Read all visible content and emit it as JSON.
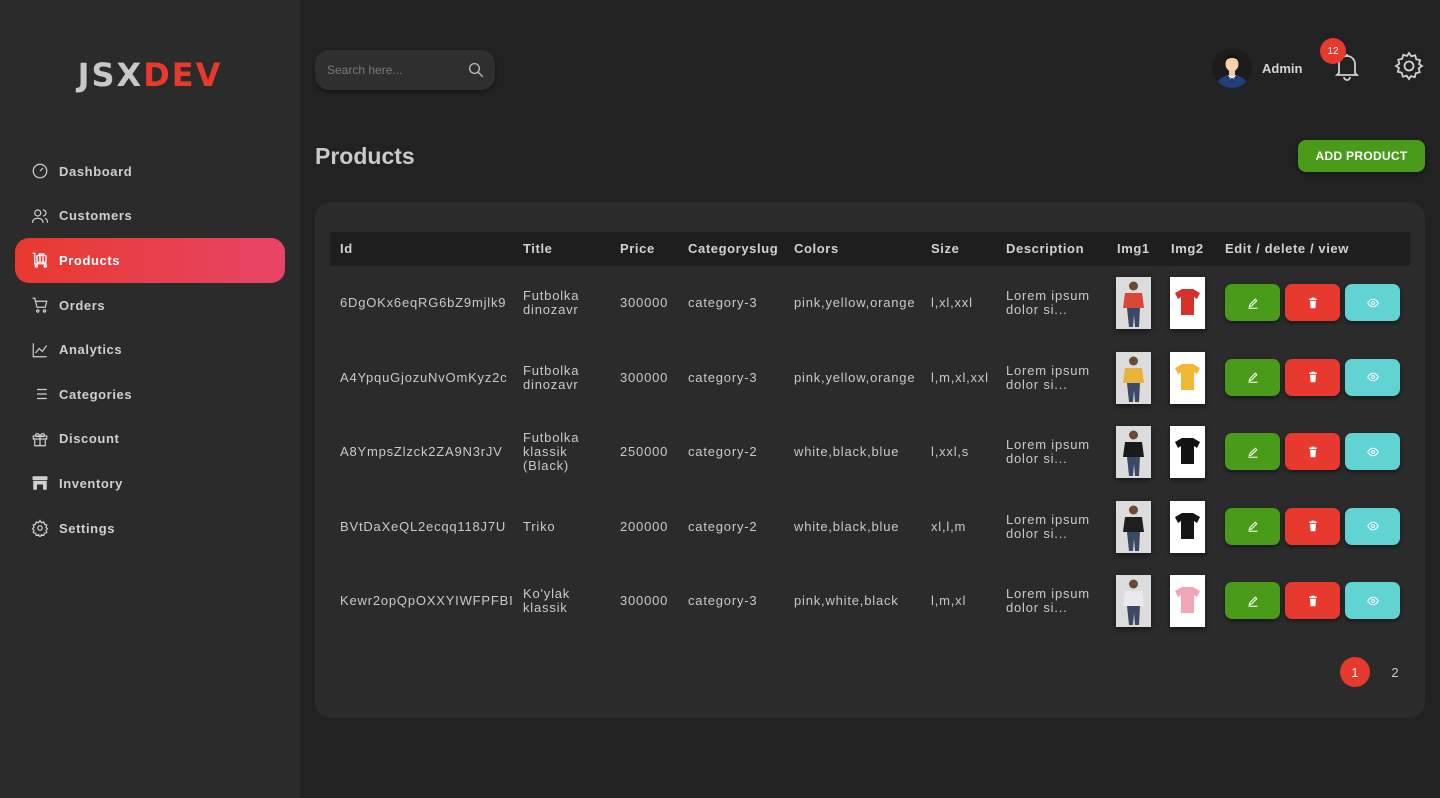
{
  "brand": {
    "part1": "JSX",
    "part2": "DEV"
  },
  "sidebar": {
    "items": [
      {
        "label": "Dashboard",
        "icon": "gauge-icon",
        "active": false
      },
      {
        "label": "Customers",
        "icon": "users-icon",
        "active": false
      },
      {
        "label": "Products",
        "icon": "luggage-cart-icon",
        "active": true
      },
      {
        "label": "Orders",
        "icon": "cart-icon",
        "active": false
      },
      {
        "label": "Analytics",
        "icon": "line-chart-icon",
        "active": false
      },
      {
        "label": "Categories",
        "icon": "list-icon",
        "active": false
      },
      {
        "label": "Discount",
        "icon": "gift-icon",
        "active": false
      },
      {
        "label": "Inventory",
        "icon": "store-icon",
        "active": false
      },
      {
        "label": "Settings",
        "icon": "gear-icon",
        "active": false
      }
    ]
  },
  "header": {
    "search_placeholder": "Search here...",
    "user_name": "Admin",
    "notification_count": "12"
  },
  "page": {
    "title": "Products",
    "add_button": "ADD PRODUCT"
  },
  "table": {
    "columns": [
      "Id",
      "Title",
      "Price",
      "Categoryslug",
      "Colors",
      "Size",
      "Description",
      "Img1",
      "Img2",
      "Edit / delete / view"
    ],
    "rows": [
      {
        "id": "6DgOKx6eqRG6bZ9mjlk9",
        "title": "Futbolka dinozavr",
        "price": "300000",
        "category": "category-3",
        "colors": "pink,yellow,orange",
        "size": "l,xl,xxl",
        "description": "Lorem ipsum dolor si...",
        "img1_color": "#d9473b",
        "img2_color": "#d6312b"
      },
      {
        "id": "A4YpquGjozuNvOmKyz2c",
        "title": "Futbolka dinozavr",
        "price": "300000",
        "category": "category-3",
        "colors": "pink,yellow,orange",
        "size": "l,m,xl,xxl",
        "description": "Lorem ipsum dolor si...",
        "img1_color": "#e8b33a",
        "img2_color": "#f1b834"
      },
      {
        "id": "A8YmpsZlzck2ZA9N3rJV",
        "title": "Futbolka klassik (Black)",
        "price": "250000",
        "category": "category-2",
        "colors": "white,black,blue",
        "size": "l,xxl,s",
        "description": "Lorem ipsum dolor si...",
        "img1_color": "#1a1a1a",
        "img2_color": "#121212"
      },
      {
        "id": "BVtDaXeQL2ecqq118J7U",
        "title": "Triko",
        "price": "200000",
        "category": "category-2",
        "colors": "white,black,blue",
        "size": "xl,l,m",
        "description": "Lorem ipsum dolor si...",
        "img1_color": "#1f1f1f",
        "img2_color": "#151515"
      },
      {
        "id": "Kewr2opQpOXXYIWFPFBI",
        "title": "Ko'ylak klassik",
        "price": "300000",
        "category": "category-3",
        "colors": "pink,white,black",
        "size": "l,m,xl",
        "description": "Lorem ipsum dolor si...",
        "img1_color": "#e9e9ee",
        "img2_color": "#f2a6b5"
      }
    ]
  },
  "pagination": {
    "pages": [
      "1",
      "2"
    ],
    "current": "1"
  },
  "colors": {
    "accent": "#e8392f",
    "green": "#4a9b1a",
    "cyan": "#62d3d3",
    "sidebar_bg": "#2b2b2b",
    "page_bg": "#222222"
  }
}
